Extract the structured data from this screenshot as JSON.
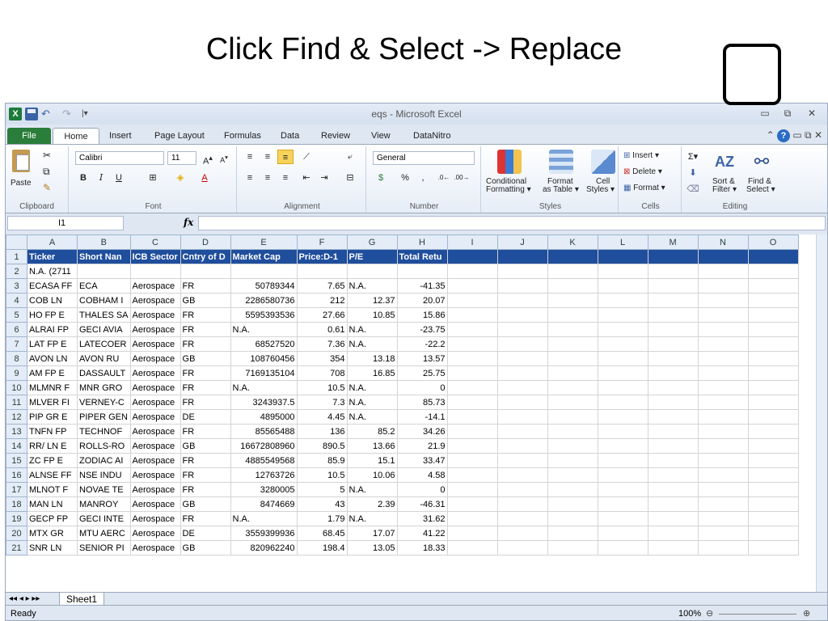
{
  "slide": {
    "title": "Click Find & Select -> Replace"
  },
  "window": {
    "title": "eqs - Microsoft Excel"
  },
  "tabs": [
    "File",
    "Home",
    "Insert",
    "Page Layout",
    "Formulas",
    "Data",
    "Review",
    "View",
    "DataNitro"
  ],
  "ribbon": {
    "clipboard": {
      "paste": "Paste",
      "label": "Clipboard"
    },
    "font": {
      "name": "Calibri",
      "size": "11",
      "label": "Font"
    },
    "alignment": {
      "label": "Alignment"
    },
    "number": {
      "format": "General",
      "label": "Number"
    },
    "styles": {
      "conditional": "Conditional",
      "conditional2": "Formatting ▾",
      "format_table": "Format",
      "format_table2": "as Table ▾",
      "cell": "Cell",
      "cell2": "Styles ▾",
      "label": "Styles"
    },
    "cells": {
      "insert": "Insert ▾",
      "delete": "Delete ▾",
      "format": "Format ▾",
      "label": "Cells"
    },
    "editing": {
      "sort": "Sort &",
      "sort2": "Filter ▾",
      "find": "Find &",
      "find2": "Select ▾",
      "label": "Editing"
    }
  },
  "formula_bar": {
    "name_box": "I1",
    "fx": "fx",
    "value": ""
  },
  "grid": {
    "columns": [
      "A",
      "B",
      "C",
      "D",
      "E",
      "F",
      "G",
      "H",
      "I",
      "J",
      "K",
      "L",
      "M",
      "N",
      "O"
    ],
    "rows": [
      [
        "Ticker",
        "Short Nan",
        "ICB Sector",
        "Cntry of D",
        "Market Cap",
        "Price:D-1",
        "P/E",
        "Total Retu"
      ],
      [
        "N.A. (2711",
        "",
        "",
        "",
        "",
        "",
        "",
        ""
      ],
      [
        "ECASA  FF",
        "ECA",
        "Aerospace",
        "FR",
        "50789344",
        "7.65",
        "N.A.",
        "-41.35"
      ],
      [
        "COB    LN",
        "COBHAM I",
        "Aerospace",
        "GB",
        "2286580736",
        "212",
        "12.37",
        "20.07"
      ],
      [
        "HO     FP E",
        "THALES SA",
        "Aerospace",
        "FR",
        "5595393536",
        "27.66",
        "10.85",
        "15.86"
      ],
      [
        "ALRAI  FP",
        "GECI AVIA",
        "Aerospace",
        "FR",
        "N.A.",
        "0.61",
        "N.A.",
        "-23.75"
      ],
      [
        "LAT    FP E",
        "LATECOER",
        "Aerospace",
        "FR",
        "68527520",
        "7.36",
        "N.A.",
        "-22.2"
      ],
      [
        "AVON   LN",
        "AVON RU",
        "Aerospace",
        "GB",
        "108760456",
        "354",
        "13.18",
        "13.57"
      ],
      [
        "AM     FP E",
        "DASSAULT",
        "Aerospace",
        "FR",
        "7169135104",
        "708",
        "16.85",
        "25.75"
      ],
      [
        "MLMNR  F",
        "MNR GRO",
        "Aerospace",
        "FR",
        "N.A.",
        "10.5",
        "N.A.",
        "0"
      ],
      [
        "MLVER  FI",
        "VERNEY-C",
        "Aerospace",
        "FR",
        "3243937.5",
        "7.3",
        "N.A.",
        "85.73"
      ],
      [
        "PIP    GR E",
        "PIPER GEN",
        "Aerospace",
        "DE",
        "4895000",
        "4.45",
        "N.A.",
        "-14.1"
      ],
      [
        "TNFN   FP",
        "TECHNOF",
        "Aerospace",
        "FR",
        "85565488",
        "136",
        "85.2",
        "34.26"
      ],
      [
        "RR/    LN E",
        "ROLLS-RO",
        "Aerospace",
        "GB",
        "16672808960",
        "890.5",
        "13.66",
        "21.9"
      ],
      [
        "ZC     FP E",
        "ZODIAC AI",
        "Aerospace",
        "FR",
        "4885549568",
        "85.9",
        "15.1",
        "33.47"
      ],
      [
        "ALNSE  FF",
        "NSE INDU",
        "Aerospace",
        "FR",
        "12763726",
        "10.5",
        "10.06",
        "4.58"
      ],
      [
        "MLNOT  F",
        "NOVAE TE",
        "Aerospace",
        "FR",
        "3280005",
        "5",
        "N.A.",
        "0"
      ],
      [
        "MAN    LN",
        "MANROY",
        "Aerospace",
        "GB",
        "8474669",
        "43",
        "2.39",
        "-46.31"
      ],
      [
        "GECP   FP",
        "GECI INTE",
        "Aerospace",
        "FR",
        "N.A.",
        "1.79",
        "N.A.",
        "31.62"
      ],
      [
        "MTX    GR",
        "MTU AERC",
        "Aerospace",
        "DE",
        "3559399936",
        "68.45",
        "17.07",
        "41.22"
      ],
      [
        "SNR    LN",
        "SENIOR PI",
        "Aerospace",
        "GB",
        "820962240",
        "198.4",
        "13.05",
        "18.33"
      ]
    ]
  },
  "sheet_tab": "Sheet1",
  "status": {
    "ready": "Ready",
    "zoom": "100%"
  }
}
